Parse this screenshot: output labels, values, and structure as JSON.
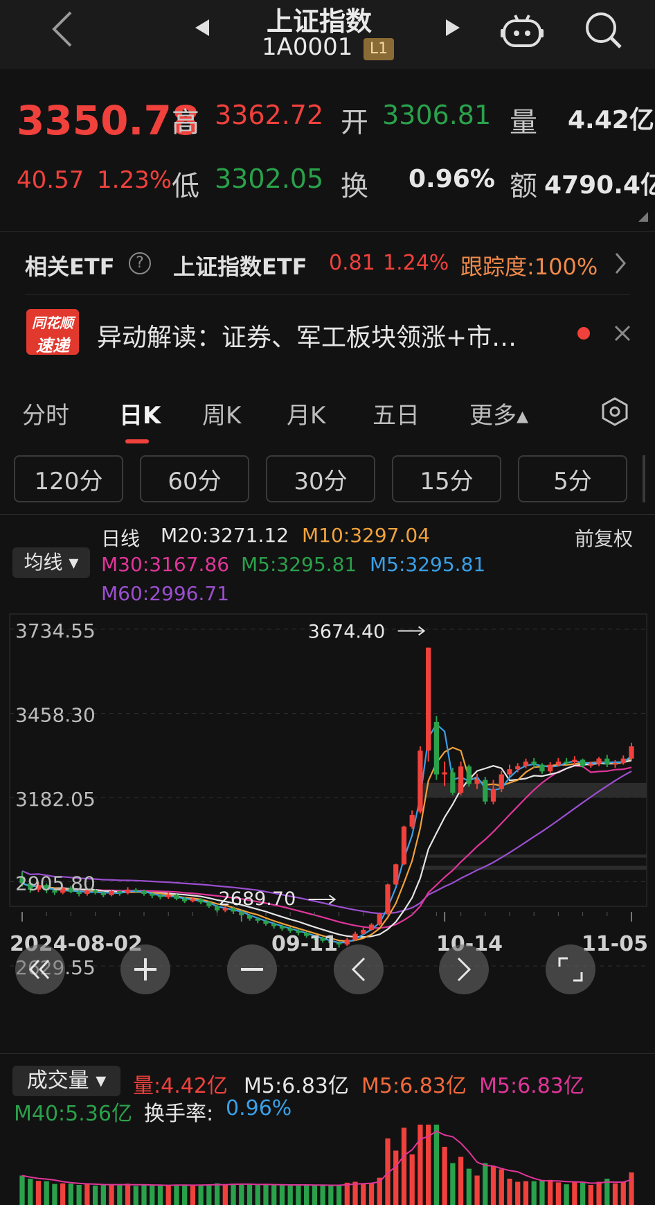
{
  "header": {
    "title": "上证指数",
    "code": "1A0001",
    "level_badge": "L1"
  },
  "quote": {
    "price": "3350.78",
    "change": "40.57",
    "change_pct": "1.23%",
    "high_label": "高",
    "high": "3362.72",
    "low_label": "低",
    "low": "3302.05",
    "open_label": "开",
    "open": "3306.81",
    "turnover_label": "换",
    "turnover": "0.96%",
    "volume_label": "量",
    "volume": "4.42亿",
    "amount_label": "额",
    "amount": "4790.4亿"
  },
  "etf": {
    "label": "相关ETF",
    "name": "上证指数ETF",
    "price": "0.81",
    "pct": "1.24%",
    "tracking": "跟踪度:100%"
  },
  "news": {
    "logo_line1": "同花顺",
    "logo_line2": "速递",
    "text": "异动解读：证券、军工板块领涨+市…"
  },
  "period_tabs": [
    "分时",
    "日K",
    "周K",
    "月K",
    "五日",
    "更多▴"
  ],
  "minute_pills": [
    "120分",
    "60分",
    "30分",
    "15分",
    "5分"
  ],
  "ma_legend": {
    "line_type": "日线",
    "adjust": "前复权",
    "selector": "均线 ▾",
    "m20": "M20:3271.12",
    "m10": "M10:3297.04",
    "m30": "M30:3167.86",
    "m5a": "M5:3295.81",
    "m5b": "M5:3295.81",
    "m60": "M60:2996.71"
  },
  "vol_legend": {
    "selector": "成交量 ▾",
    "vol": "量:4.42亿",
    "m5a": "M5:6.83亿",
    "m5b": "M5:6.83亿",
    "m5c": "M5:6.83亿",
    "m40": "M40:5.36亿",
    "turnover_label": "换手率:",
    "turnover": "0.96%"
  },
  "colors": {
    "up": "#f0413c",
    "down": "#2aa14b",
    "ma5": "#e6e6e6",
    "ma10": "#f0a23c",
    "ma20": "#3aa0e8",
    "ma30": "#e0359a",
    "ma60": "#9b4fd0"
  },
  "chart_data": {
    "type": "candlestick",
    "y_ticks": [
      "3734.55",
      "3458.30",
      "3182.05",
      "2905.80",
      "2629.55"
    ],
    "x_ticks": [
      "2024-08-02",
      "09-11",
      "10-14",
      "11-05"
    ],
    "high_annotation": "3674.40",
    "low_annotation": "2689.70",
    "ylim": [
      2629.55,
      3734.55
    ],
    "last_close": 3350.78,
    "candles": [
      [
        2922,
        2901,
        2940,
        2890
      ],
      [
        2901,
        2880,
        2910,
        2870
      ],
      [
        2880,
        2895,
        2905,
        2872
      ],
      [
        2895,
        2878,
        2900,
        2868
      ],
      [
        2878,
        2870,
        2885,
        2862
      ],
      [
        2870,
        2885,
        2890,
        2865
      ],
      [
        2885,
        2872,
        2892,
        2868
      ],
      [
        2872,
        2866,
        2878,
        2858
      ],
      [
        2866,
        2878,
        2885,
        2860
      ],
      [
        2878,
        2870,
        2882,
        2864
      ],
      [
        2870,
        2862,
        2874,
        2855
      ],
      [
        2862,
        2875,
        2880,
        2858
      ],
      [
        2875,
        2868,
        2880,
        2860
      ],
      [
        2868,
        2880,
        2888,
        2864
      ],
      [
        2880,
        2875,
        2885,
        2868
      ],
      [
        2875,
        2866,
        2880,
        2860
      ],
      [
        2866,
        2860,
        2870,
        2852
      ],
      [
        2860,
        2855,
        2866,
        2848
      ],
      [
        2855,
        2862,
        2870,
        2850
      ],
      [
        2862,
        2850,
        2866,
        2845
      ],
      [
        2850,
        2842,
        2856,
        2836
      ],
      [
        2842,
        2848,
        2855,
        2838
      ],
      [
        2848,
        2838,
        2852,
        2832
      ],
      [
        2838,
        2826,
        2842,
        2820
      ],
      [
        2826,
        2812,
        2830,
        2805
      ],
      [
        2812,
        2820,
        2825,
        2806
      ],
      [
        2820,
        2808,
        2824,
        2800
      ],
      [
        2808,
        2796,
        2812,
        2790
      ],
      [
        2796,
        2785,
        2800,
        2778
      ],
      [
        2785,
        2778,
        2790,
        2770
      ],
      [
        2778,
        2768,
        2782,
        2762
      ],
      [
        2768,
        2760,
        2772,
        2752
      ],
      [
        2760,
        2752,
        2765,
        2745
      ],
      [
        2752,
        2745,
        2758,
        2738
      ],
      [
        2745,
        2738,
        2750,
        2730
      ],
      [
        2738,
        2728,
        2742,
        2722
      ],
      [
        2728,
        2720,
        2732,
        2714
      ],
      [
        2720,
        2712,
        2725,
        2706
      ],
      [
        2712,
        2705,
        2716,
        2698
      ],
      [
        2705,
        2700,
        2710,
        2690
      ],
      [
        2700,
        2716,
        2722,
        2695
      ],
      [
        2716,
        2735,
        2742,
        2712
      ],
      [
        2735,
        2748,
        2755,
        2730
      ],
      [
        2748,
        2765,
        2770,
        2745
      ],
      [
        2765,
        2800,
        2805,
        2762
      ],
      [
        2800,
        2897,
        2900,
        2798
      ],
      [
        2897,
        2963,
        2965,
        2895
      ],
      [
        2963,
        3087,
        3090,
        2960
      ],
      [
        3087,
        3125,
        3140,
        3080
      ],
      [
        3136,
        3336,
        3350,
        3130
      ],
      [
        3336,
        3674,
        3674,
        3300
      ],
      [
        3430,
        3258,
        3450,
        3240
      ],
      [
        3258,
        3265,
        3300,
        3220
      ],
      [
        3265,
        3198,
        3280,
        3190
      ],
      [
        3198,
        3284,
        3300,
        3190
      ],
      [
        3284,
        3227,
        3290,
        3218
      ],
      [
        3227,
        3240,
        3260,
        3210
      ],
      [
        3240,
        3169,
        3250,
        3160
      ],
      [
        3169,
        3210,
        3240,
        3160
      ],
      [
        3210,
        3258,
        3270,
        3200
      ],
      [
        3258,
        3275,
        3290,
        3250
      ],
      [
        3275,
        3285,
        3295,
        3265
      ],
      [
        3285,
        3300,
        3310,
        3278
      ],
      [
        3300,
        3290,
        3312,
        3280
      ],
      [
        3290,
        3268,
        3295,
        3260
      ],
      [
        3268,
        3290,
        3298,
        3262
      ],
      [
        3290,
        3300,
        3312,
        3284
      ],
      [
        3300,
        3298,
        3312,
        3290
      ],
      [
        3298,
        3306,
        3318,
        3290
      ],
      [
        3306,
        3286,
        3310,
        3280
      ],
      [
        3286,
        3292,
        3300,
        3280
      ],
      [
        3292,
        3310,
        3315,
        3285
      ],
      [
        3310,
        3290,
        3322,
        3282
      ],
      [
        3290,
        3295,
        3305,
        3280
      ],
      [
        3295,
        3310,
        3320,
        3290
      ],
      [
        3310,
        3350,
        3362,
        3302
      ]
    ]
  }
}
